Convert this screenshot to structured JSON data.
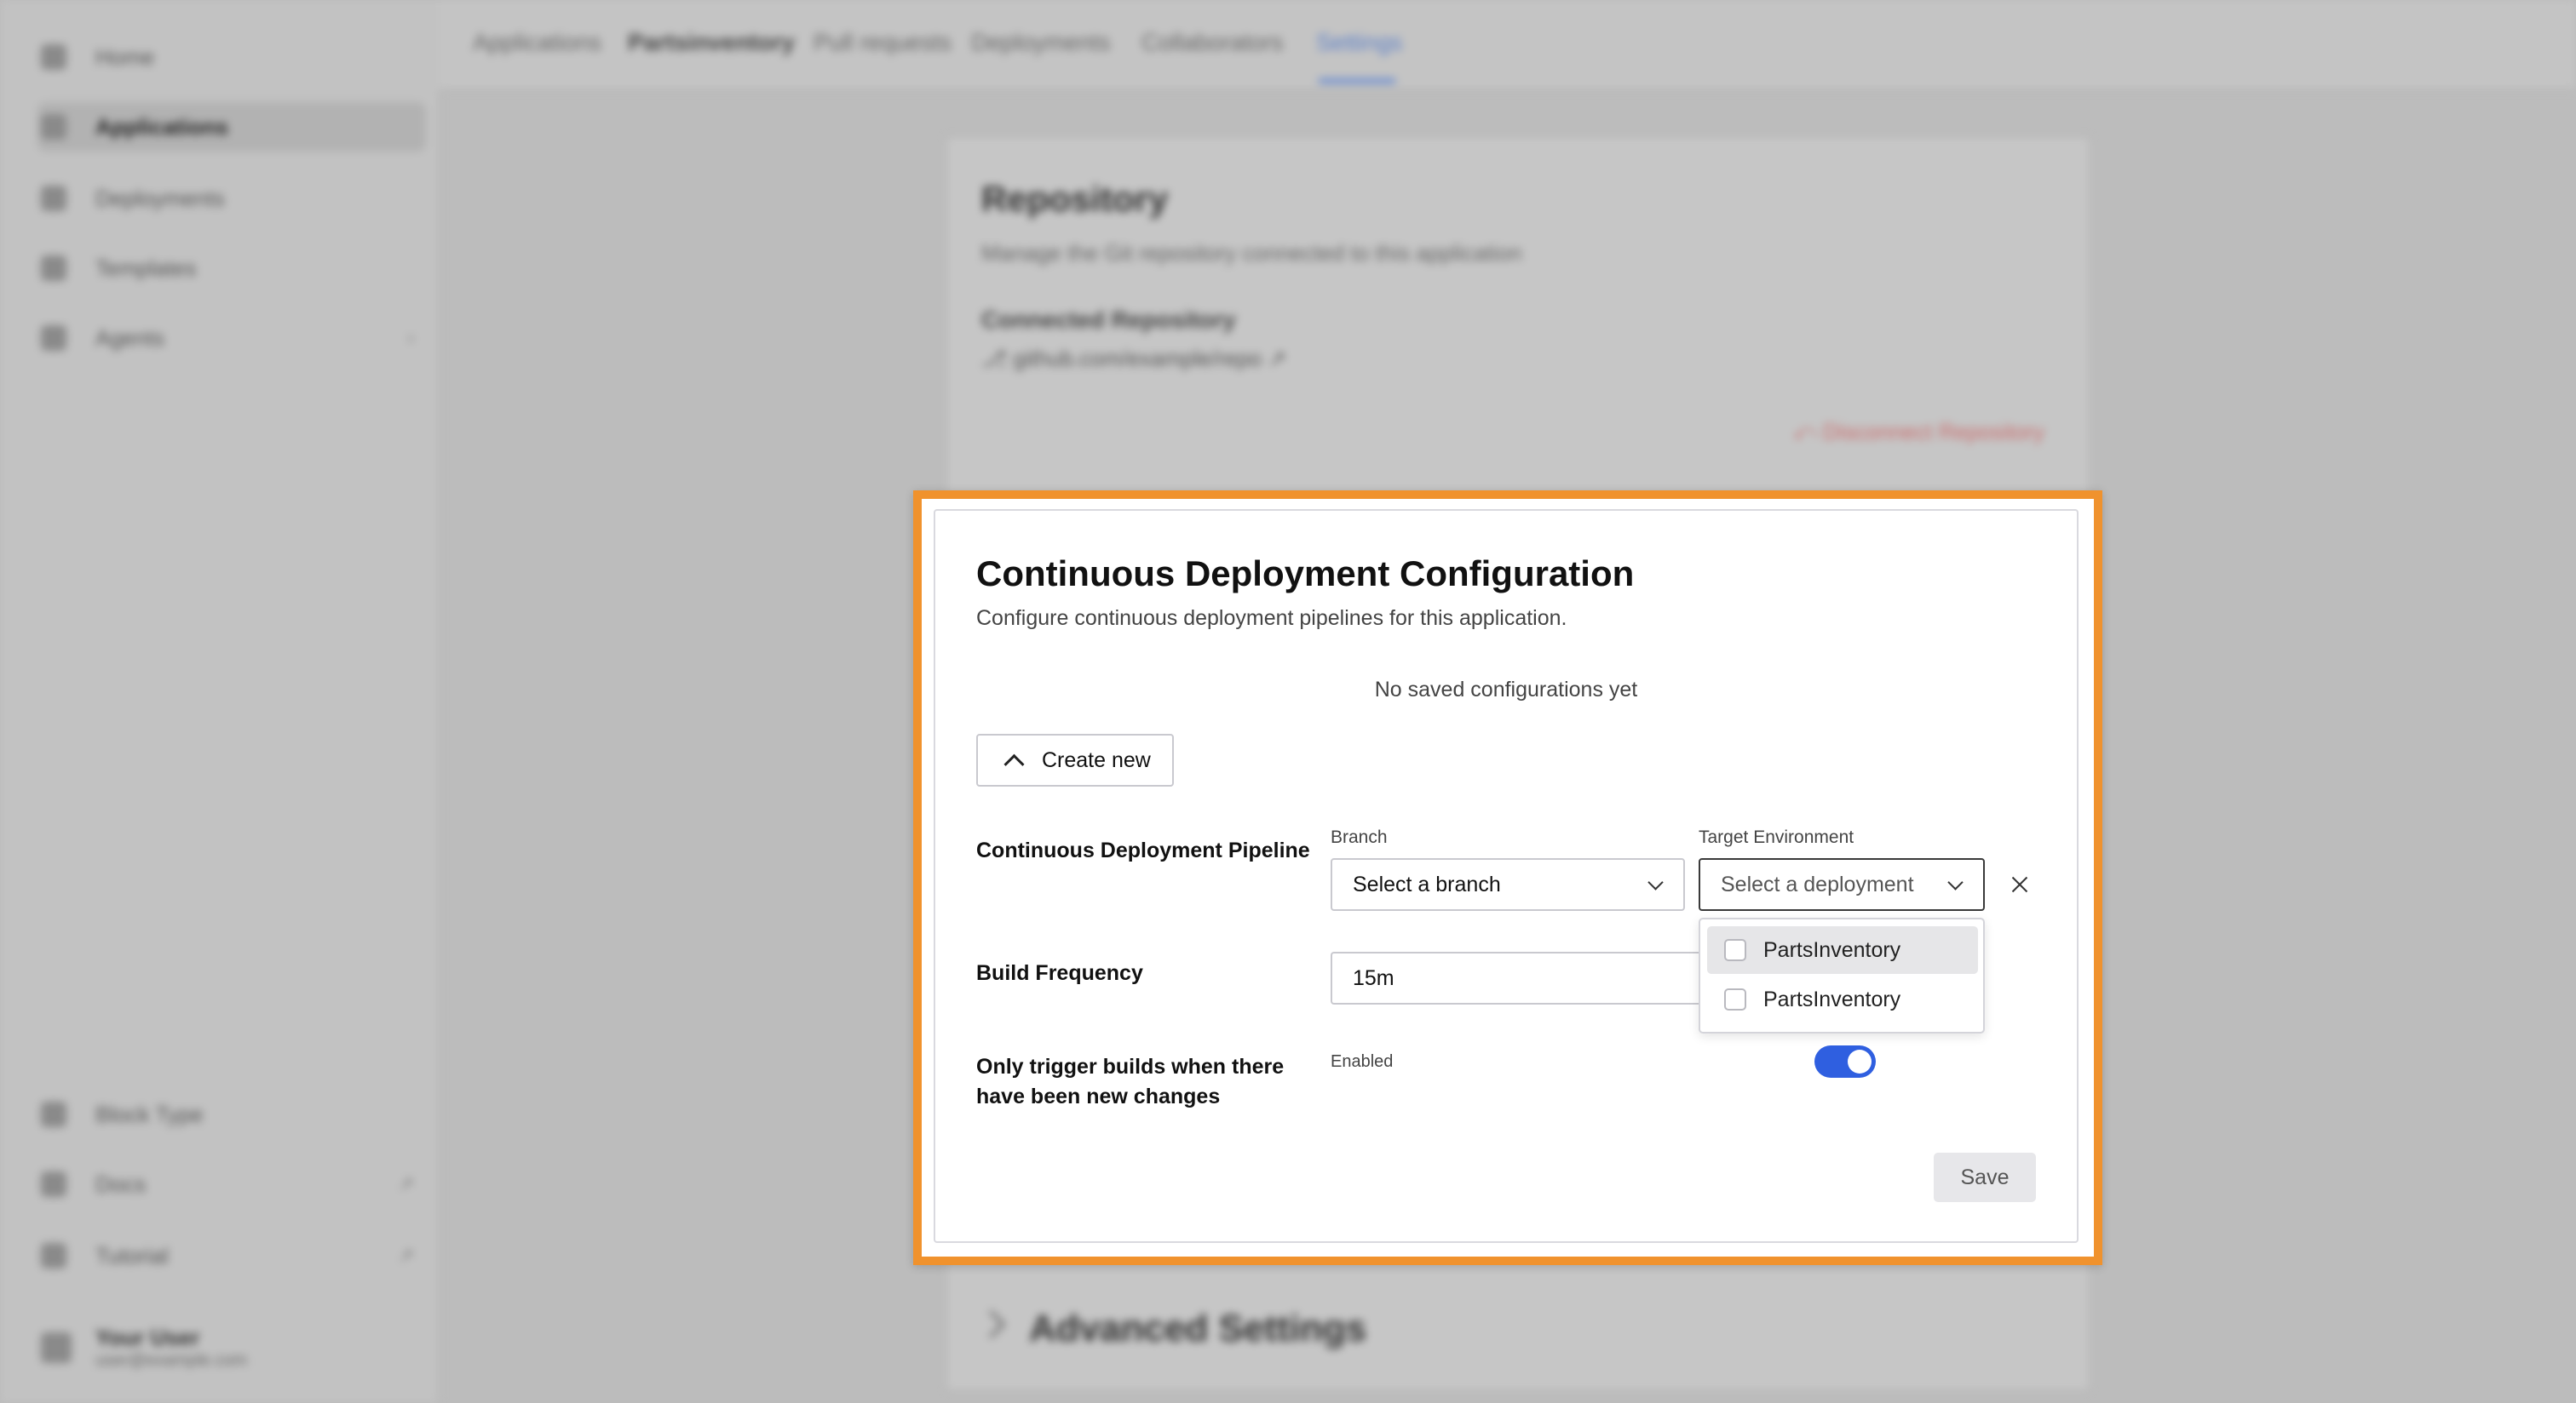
{
  "sidebar": {
    "items": [
      {
        "label": "Home",
        "icon": "home-icon"
      },
      {
        "label": "Applications",
        "icon": "apps-icon",
        "active": true
      },
      {
        "label": "Deployments",
        "icon": "rocket-icon"
      },
      {
        "label": "Templates",
        "icon": "template-icon"
      },
      {
        "label": "Agents",
        "icon": "agent-icon"
      }
    ],
    "bottom_items": [
      {
        "label": "Block Type",
        "icon": "block-icon"
      },
      {
        "label": "Docs",
        "icon": "docs-icon",
        "badge": "↗"
      },
      {
        "label": "Tutorial",
        "icon": "tutorial-icon",
        "badge": "↗"
      }
    ],
    "user": {
      "name": "Your User",
      "email": "user@example.com"
    }
  },
  "tabs": [
    "Applications",
    "Partsinventory",
    "Pull requests",
    "Deployments",
    "Collaborators",
    "Settings"
  ],
  "background_card": {
    "title": "Repository",
    "subtitle": "Manage the Git repository connected to this application",
    "connected_label": "Connected Repository",
    "connected_value": "⎇ github.com/example/repo ↗",
    "disconnect_label": "⤺ Disconnect Repository",
    "advanced_label": "Advanced Settings"
  },
  "modal": {
    "title": "Continuous Deployment Configuration",
    "description": "Configure continuous deployment pipelines for this application.",
    "empty_state": "No saved configurations yet",
    "create_button": "Create new",
    "pipeline_label": "Continuous Deployment Pipeline",
    "branch_label": "Branch",
    "branch_placeholder": "Select a branch",
    "target_label": "Target Environment",
    "target_placeholder": "Select a deployment",
    "build_frequency_label": "Build Frequency",
    "build_frequency_value": "15m",
    "trigger_label": "Only trigger builds when there have been new changes",
    "enabled_label": "Enabled",
    "toggle_on": true,
    "save_button": "Save",
    "dropdown_options": [
      "PartsInventory",
      "PartsInventory"
    ]
  },
  "colors": {
    "highlight_border": "#f0922d",
    "toggle_accent": "#2f5fe0",
    "active_tab": "#5b7fc8"
  }
}
